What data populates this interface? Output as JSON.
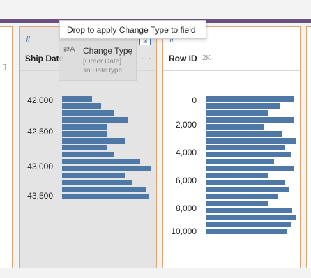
{
  "tooltip": {
    "text": "Drop to apply Change Type to field"
  },
  "drag_chip": {
    "icon": "change-type-icon",
    "title": "Change Type",
    "line1": "[Order Date]",
    "line2": "To Date type"
  },
  "ship_date": {
    "type_symbol": "#",
    "name": "Ship Date",
    "more": "···",
    "ticks": [
      "42,000",
      "42,500",
      "43,000",
      "43,500"
    ],
    "bins": [
      0.33,
      0.43,
      0.57,
      0.73,
      0.49,
      0.49,
      0.69,
      0.49,
      0.57,
      0.86,
      0.98,
      0.69,
      0.78,
      0.92,
      0.96
    ]
  },
  "row_id": {
    "type_symbol": "#",
    "name": "Row ID",
    "count": "2K",
    "ticks": [
      "0",
      "2,000",
      "4,000",
      "6,000",
      "8,000",
      "10,000"
    ],
    "bins": [
      0.98,
      0.82,
      0.7,
      0.98,
      0.65,
      0.85,
      1.0,
      0.88,
      0.95,
      0.76,
      0.98,
      0.7,
      0.88,
      0.93,
      0.81,
      0.7,
      0.96,
      1.0,
      0.95,
      0.91
    ]
  },
  "colors": {
    "accent": "#6b4f7e",
    "card_border": "#e3a46f",
    "bar": "#4e79a7"
  }
}
